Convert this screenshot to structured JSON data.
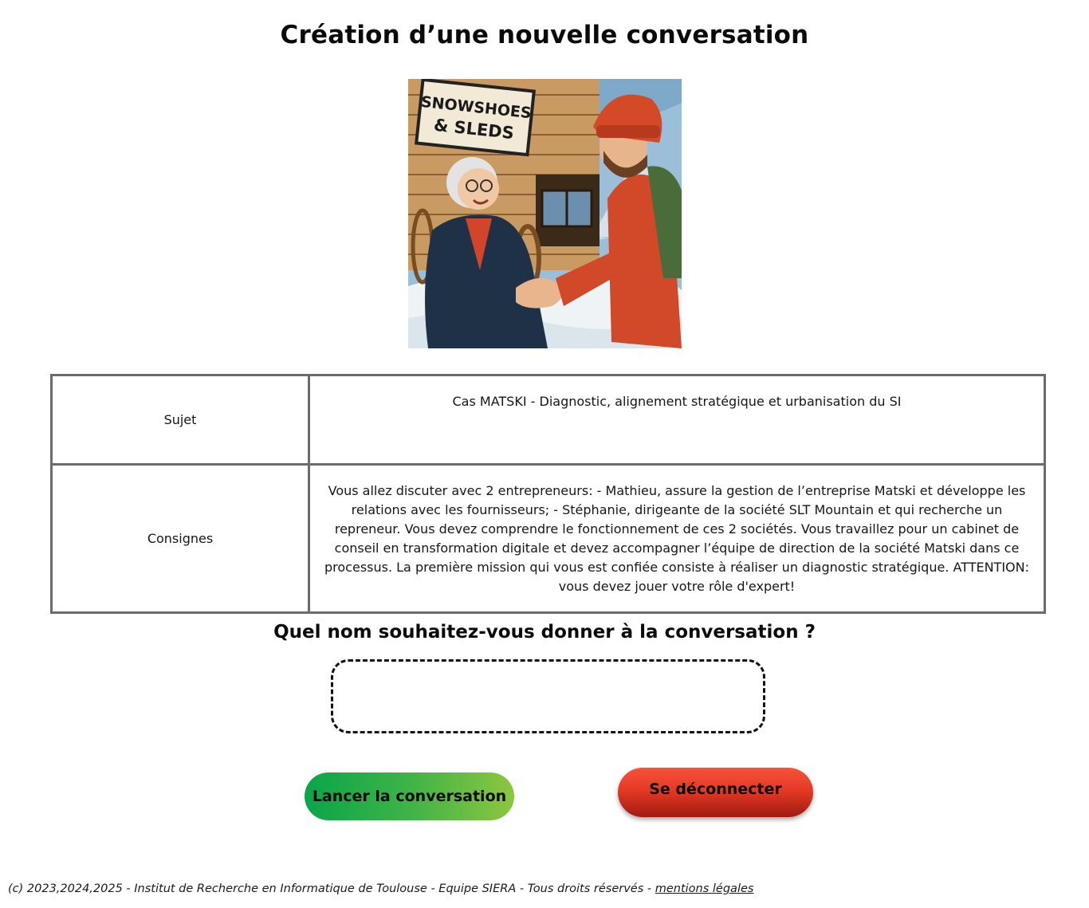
{
  "page": {
    "title": "Création d’une nouvelle conversation"
  },
  "illustration": {
    "sign_line1": "SNOWSHOES",
    "sign_line2": "& SLEDS"
  },
  "info_table": {
    "rows": [
      {
        "label": "Sujet",
        "value": "Cas MATSKI - Diagnostic, alignement stratégique et urbanisation du SI"
      },
      {
        "label": "Consignes",
        "value": "Vous allez discuter avec 2 entrepreneurs: - Mathieu, assure la gestion de l’entreprise Matski et développe les relations avec les fournisseurs; - Stéphanie, dirigeante de la société SLT Mountain et qui recherche un repreneur. Vous devez comprendre le fonctionnement de ces 2 sociétés. Vous travaillez pour un cabinet de conseil en transformation digitale et devez accompagner l’équipe de direction de la société Matski dans ce processus. La première mission qui vous est confiée consiste à réaliser un diagnostic stratégique. ATTENTION: vous devez jouer votre rôle d'expert!"
      }
    ]
  },
  "form": {
    "question": "Quel nom souhaitez-vous donner à la conversation ?",
    "name_value": "",
    "name_placeholder": ""
  },
  "buttons": {
    "launch_label": "Lancer la conversation",
    "logout_label": "Se déconnecter"
  },
  "footer": {
    "text": "(c) 2023,2024,2025 - Institut de Recherche en Informatique de Toulouse - Equipe SIERA - Tous droits réservés - ",
    "link_label": "mentions légales"
  },
  "colors": {
    "launch_gradient": [
      "#0aa54a",
      "#8dc63f"
    ],
    "logout_gradient": [
      "#f7523b",
      "#a01a10"
    ],
    "table_border": "#6b6b6b"
  }
}
